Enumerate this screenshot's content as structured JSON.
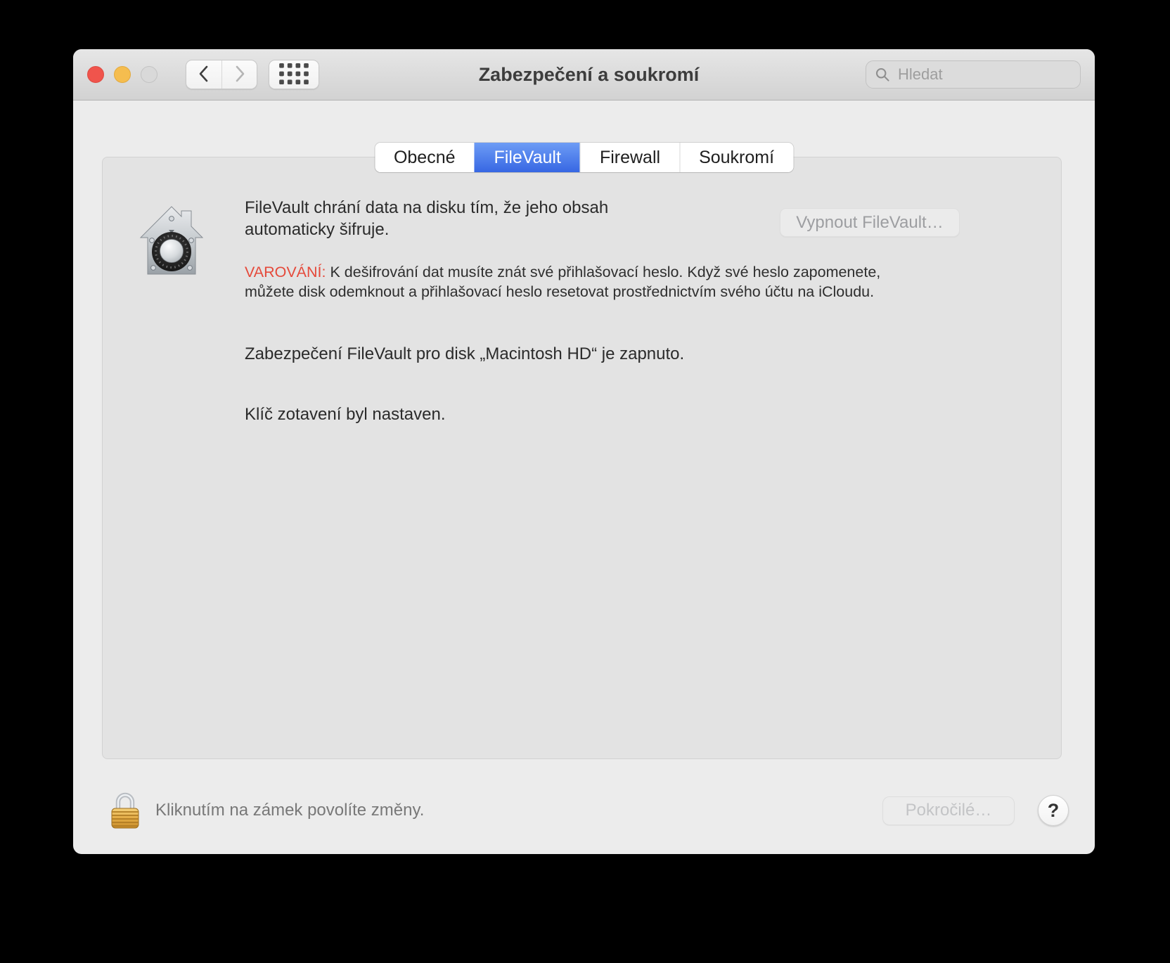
{
  "window": {
    "title": "Zabezpečení a soukromí",
    "search_placeholder": "Hledat"
  },
  "tabs": [
    {
      "label": "Obecné",
      "selected": false
    },
    {
      "label": "FileVault",
      "selected": true
    },
    {
      "label": "Firewall",
      "selected": false
    },
    {
      "label": "Soukromí",
      "selected": false
    }
  ],
  "filevault": {
    "description": "FileVault chrání data na disku tím, že jeho obsah automaticky šifruje.",
    "turn_off_button": "Vypnout FileVault…",
    "warning_label": "VAROVÁNÍ:",
    "warning_text": " K dešifrování dat musíte znát své přihlašovací heslo. Když své heslo zapomenete, můžete disk odemknout a přihlašovací heslo resetovat prostřednictvím svého účtu na iCloudu.",
    "status_enabled": "Zabezpečení FileVault pro disk „Macintosh HD“ je zapnuto.",
    "status_recovery_key": "Klíč zotavení byl nastaven."
  },
  "footer": {
    "lock_text": "Kliknutím na zámek povolíte změny.",
    "advanced_button": "Pokročilé…",
    "help_button": "?"
  },
  "icons": {
    "back": "chevron-left",
    "forward": "chevron-right",
    "show_all": "grid-of-dots",
    "search": "magnifying-glass",
    "filevault": "house-with-combination-lock-dial",
    "lock": "closed-gold-padlock",
    "help": "question-mark"
  },
  "colors": {
    "selected_tab_blue_top": "#6d9cf5",
    "selected_tab_blue_bottom": "#3767e3",
    "warning_red": "#e5493a",
    "toolbar_gray": "#d9d9d9",
    "panel_gray": "#e3e3e3"
  }
}
